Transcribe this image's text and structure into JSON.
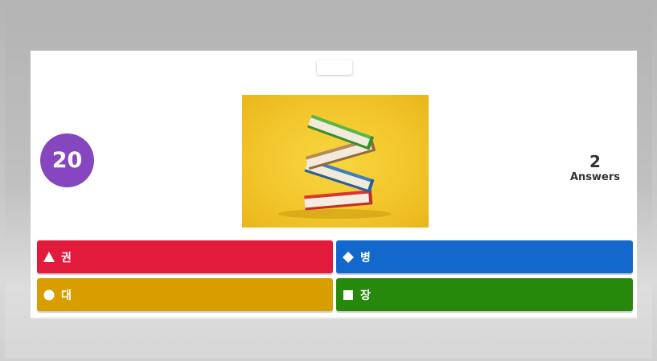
{
  "timer": {
    "value": "20"
  },
  "answers_counter": {
    "count": "2",
    "label": "Answers"
  },
  "image": {
    "subject": "stack-of-books"
  },
  "choices": [
    {
      "shape": "triangle-icon",
      "label": "권",
      "color": "#e21b3c"
    },
    {
      "shape": "diamond-icon",
      "label": "병",
      "color": "#1368ce"
    },
    {
      "shape": "circle-icon",
      "label": "대",
      "color": "#d89e00"
    },
    {
      "shape": "square-icon",
      "label": "장",
      "color": "#26890c"
    }
  ],
  "colors": {
    "timer": "#8646c0",
    "image_background": "#f2c52a"
  }
}
